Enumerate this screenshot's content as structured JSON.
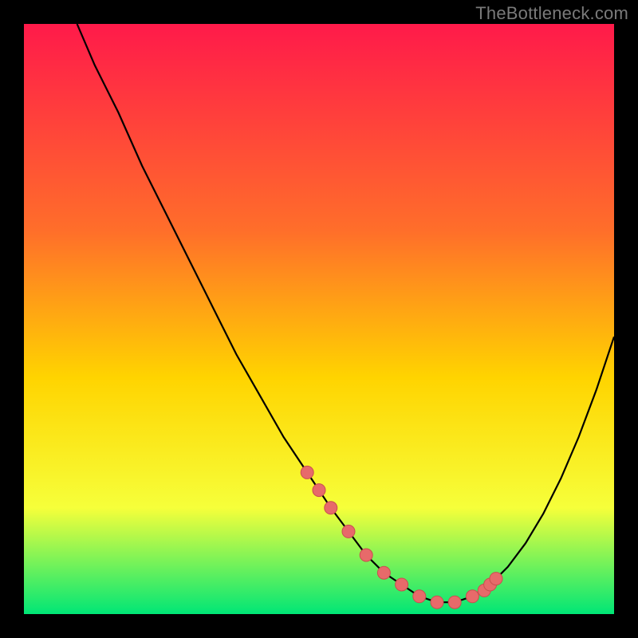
{
  "watermark": "TheBottleneck.com",
  "colors": {
    "bg": "#000000",
    "grad_top": "#ff1a4a",
    "grad_mid1": "#ff6e2a",
    "grad_mid2": "#ffd400",
    "grad_mid3": "#f6ff3a",
    "grad_bottom": "#00e676",
    "curve": "#000000",
    "marker_fill": "#e76a6a",
    "marker_stroke": "#c94f4f"
  },
  "chart_data": {
    "type": "line",
    "title": "",
    "xlabel": "",
    "ylabel": "",
    "xlim": [
      0,
      100
    ],
    "ylim": [
      0,
      100
    ],
    "series": [
      {
        "name": "bottleneck-curve",
        "x": [
          9,
          12,
          16,
          20,
          24,
          28,
          32,
          36,
          40,
          44,
          48,
          52,
          55,
          58,
          61,
          64,
          67,
          70,
          73,
          76,
          79,
          82,
          85,
          88,
          91,
          94,
          97,
          100
        ],
        "y": [
          100,
          93,
          85,
          76,
          68,
          60,
          52,
          44,
          37,
          30,
          24,
          18,
          14,
          10,
          7,
          5,
          3,
          2,
          2,
          3,
          5,
          8,
          12,
          17,
          23,
          30,
          38,
          47
        ]
      }
    ],
    "markers": {
      "name": "highlighted-points",
      "x": [
        48,
        50,
        52,
        55,
        58,
        61,
        64,
        67,
        70,
        73,
        76,
        78,
        79,
        80
      ],
      "y": [
        24,
        21,
        18,
        14,
        10,
        7,
        5,
        3,
        2,
        2,
        3,
        4,
        5,
        6
      ]
    }
  }
}
